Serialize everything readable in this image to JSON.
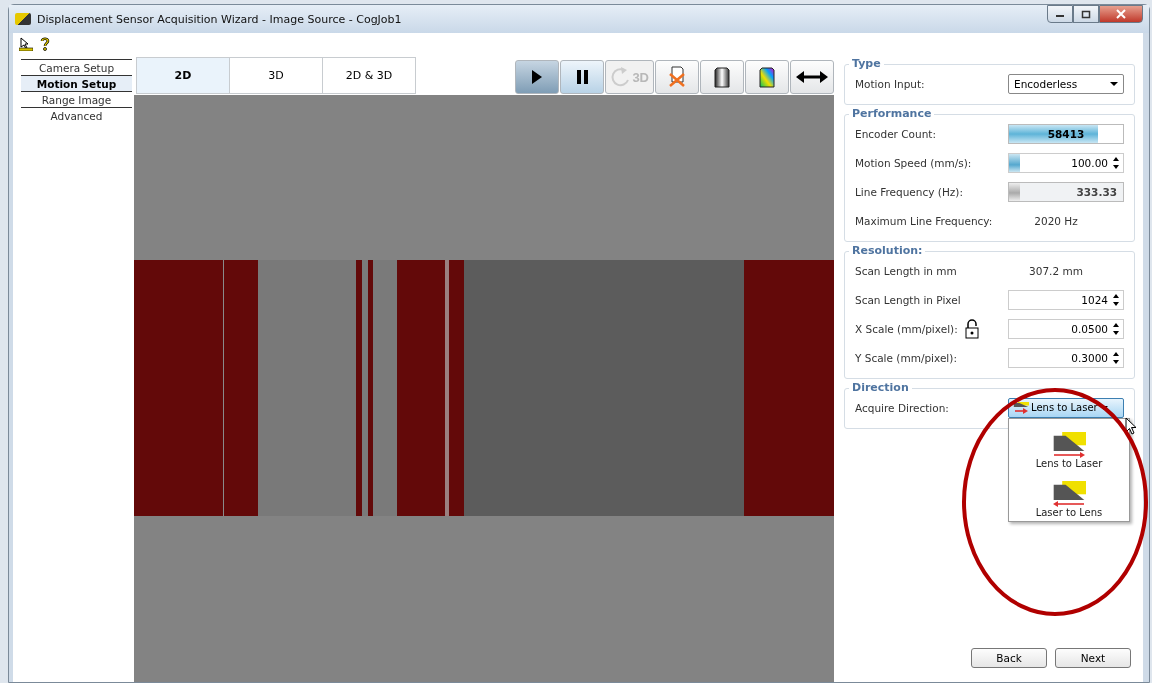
{
  "window": {
    "title": "Displacement Sensor Acquisition Wizard - Image Source - CogJob1"
  },
  "app_toolbar": [
    {
      "kind": "pointer"
    },
    {
      "kind": "help"
    }
  ],
  "nav": [
    {
      "label": "Camera Setup",
      "selected": false
    },
    {
      "label": "Motion Setup",
      "selected": true
    },
    {
      "label": "Range Image",
      "selected": false
    },
    {
      "label": "Advanced",
      "selected": false
    }
  ],
  "view_tabs": [
    {
      "label": "2D",
      "selected": true
    },
    {
      "label": "3D",
      "selected": false
    },
    {
      "label": "2D & 3D",
      "selected": false
    }
  ],
  "view_toolbar": [
    {
      "kind": "play",
      "pressed": true,
      "disabled": false
    },
    {
      "kind": "pause",
      "pressed": true,
      "disabled": false
    },
    {
      "kind": "rotate",
      "label": "3D",
      "pressed": false,
      "disabled": true
    },
    {
      "kind": "clear",
      "pressed": false,
      "disabled": false
    },
    {
      "kind": "grayscale",
      "pressed": false,
      "disabled": false
    },
    {
      "kind": "colormap",
      "pressed": false,
      "disabled": false
    },
    {
      "kind": "fit",
      "pressed": false,
      "disabled": false
    }
  ],
  "image_view": {
    "kind": "picture"
  },
  "groups": [
    {
      "title": "Type",
      "rows": [
        {
          "label": "Motion Input:",
          "kind": "dropdown",
          "value": "Encoderless"
        }
      ]
    },
    {
      "title": "Performance",
      "rows": [
        {
          "label": "Encoder Count:",
          "kind": "meter",
          "value": "58413",
          "level": 0.78
        },
        {
          "label": "Motion Speed (mm/s):",
          "kind": "spin",
          "value": "100.00",
          "level": 0.1
        },
        {
          "label": "Line Frequency (Hz):",
          "kind": "readonly",
          "value": "333.33",
          "level": 0.1
        },
        {
          "label": "Maximum Line Frequency:",
          "kind": "text",
          "value": "2020 Hz"
        }
      ]
    },
    {
      "title": "Resolution:",
      "rows": [
        {
          "label": "Scan Length in mm",
          "kind": "text",
          "value": "307.2 mm"
        },
        {
          "label": "Scan Length in Pixel",
          "kind": "spin",
          "value": "1024"
        },
        {
          "label": "X Scale (mm/pixel):",
          "kind": "spin",
          "value": "0.0500",
          "locked": false
        },
        {
          "label": "Y Scale (mm/pixel):",
          "kind": "spin",
          "value": "0.3000"
        }
      ]
    },
    {
      "title": "Direction",
      "rows": [
        {
          "label": "Acquire Direction:",
          "kind": "direction",
          "value": "Lens to Laser",
          "expanded": true,
          "options": [
            {
              "label": "Lens to Laser",
              "kind": "right"
            },
            {
              "label": "Laser to Lens",
              "kind": "left"
            }
          ]
        }
      ]
    }
  ],
  "buttons": [
    "Back",
    "Next"
  ],
  "highlight_ring": true
}
